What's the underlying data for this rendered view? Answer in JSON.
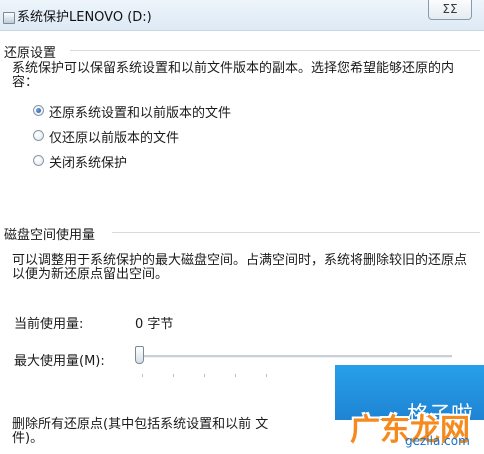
{
  "window": {
    "title": "系统保护LENOVO (D:)",
    "close_glyph": "ΣΣ"
  },
  "restore": {
    "header": "还原设置",
    "description": "系统保护可以保留系统设置和以前文件版本的副本。选择您希望能够还原的内容：",
    "options": [
      {
        "label": "还原系统设置和以前版本的文件",
        "selected": true
      },
      {
        "label": "仅还原以前版本的文件",
        "selected": false
      },
      {
        "label": "关闭系统保护",
        "selected": false
      }
    ]
  },
  "disk": {
    "header": "磁盘空间使用量",
    "description": "可以调整用于系统保护的最大磁盘空间。占满空间时，系统将删除较旧的还原点以便为新还原点留出空间。",
    "current_label": "当前使用量:",
    "current_value": "0 字节",
    "max_label": "最大使用量(M):",
    "max_fraction": 0.0
  },
  "delete": {
    "description": "删除所有还原点(其中包括系统设置和以前 文件)。"
  },
  "watermark": {
    "main": "广东龙网",
    "top": "格子啦",
    "url": "gezila.com"
  },
  "colors": {
    "accent": "#1f4f93",
    "watermark_blue": "#0b79d0",
    "watermark_orange": "#f58a1f"
  }
}
